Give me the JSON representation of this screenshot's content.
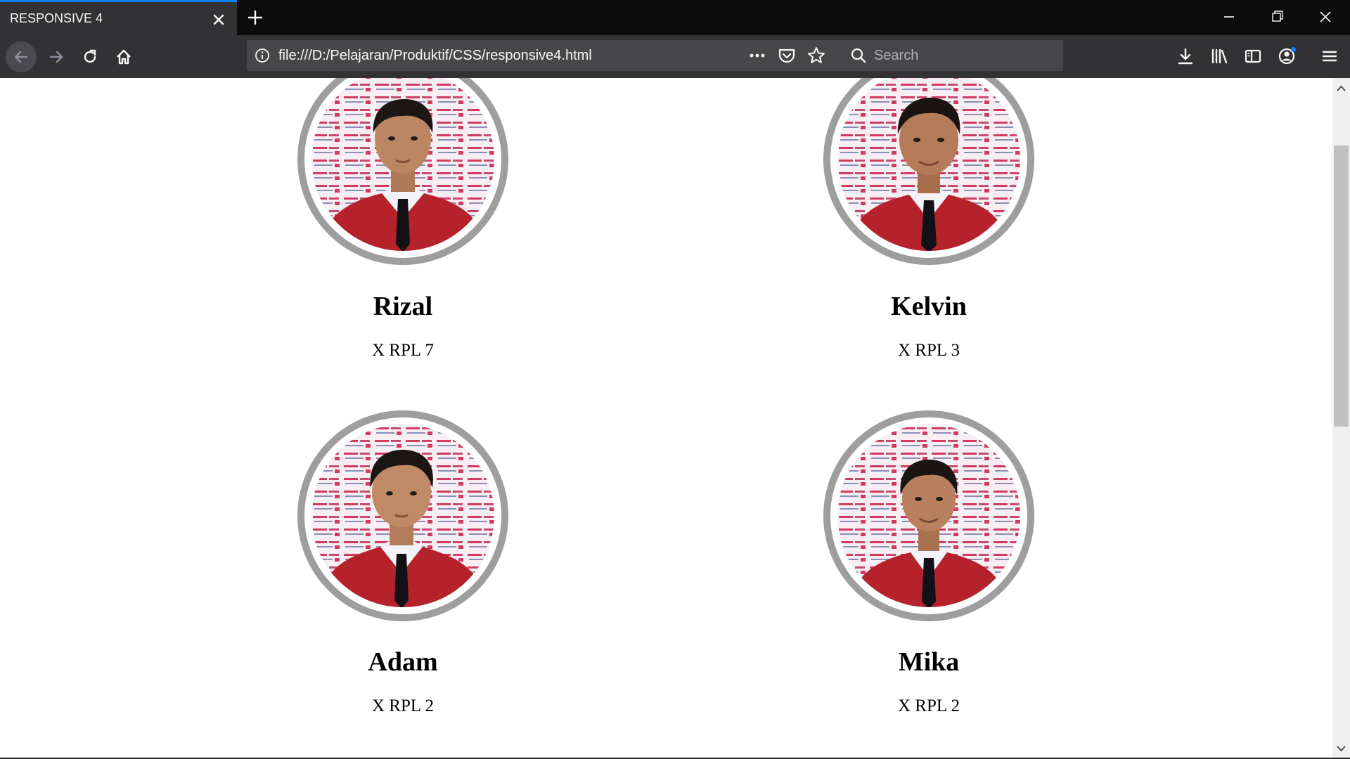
{
  "window": {
    "tab_title": "RESPONSIVE 4"
  },
  "navbar": {
    "url": "file:///D:/Pelajaran/Produktif/CSS/responsive4.html",
    "search_placeholder": "Search"
  },
  "colors": {
    "chrome_dark": "#0c0c0d",
    "chrome_toolbar": "#323234",
    "tab_accent": "#0a84ff",
    "frame_gray": "#9e9e9e",
    "blazer_red": "#b5222b"
  },
  "students": [
    {
      "name": "Rizal",
      "class": "X RPL 7"
    },
    {
      "name": "Kelvin",
      "class": "X RPL 3"
    },
    {
      "name": "Adam",
      "class": "X RPL 2"
    },
    {
      "name": "Mika",
      "class": "X RPL 2"
    }
  ]
}
